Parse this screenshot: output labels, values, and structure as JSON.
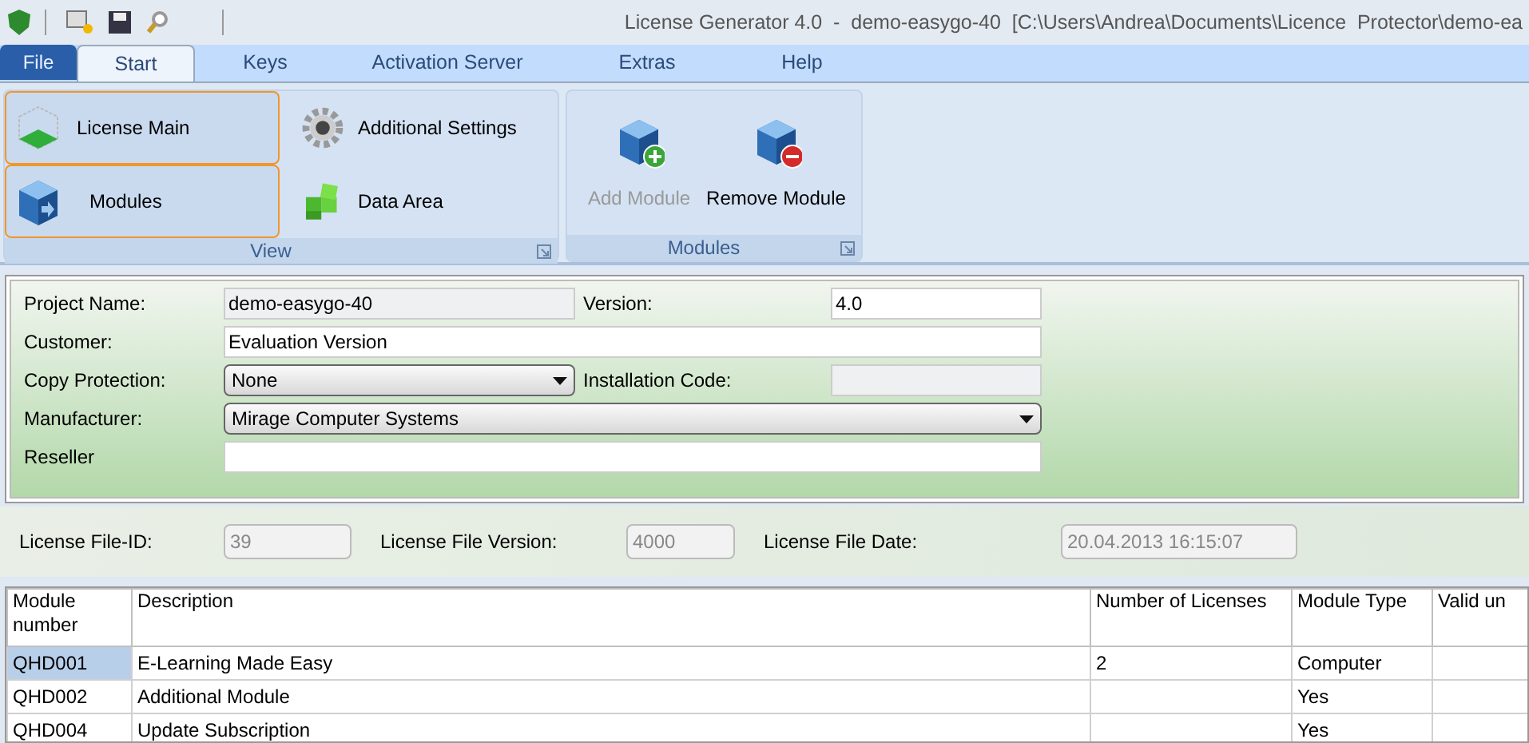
{
  "window": {
    "title": "License Generator 4.0  -  demo-easygo-40  [C:\\Users\\Andrea\\Documents\\Licence  Protector\\demo-ea"
  },
  "tabs": [
    {
      "label": "File",
      "kind": "application",
      "selected": false
    },
    {
      "label": "Start",
      "kind": "tab",
      "selected": true
    },
    {
      "label": "Keys",
      "kind": "tab",
      "selected": false
    },
    {
      "label": "Activation Server",
      "kind": "tab",
      "selected": false
    },
    {
      "label": "Extras",
      "kind": "tab",
      "selected": false
    },
    {
      "label": "Help",
      "kind": "tab",
      "selected": false
    }
  ],
  "ribbon_groups": [
    {
      "label": "View",
      "buttons": [
        {
          "label": "License Main",
          "selected": true,
          "disabled": false
        },
        {
          "label": "Modules",
          "selected": true,
          "disabled": false
        },
        {
          "label": "Additional Settings",
          "selected": false,
          "disabled": false
        },
        {
          "label": "Data Area",
          "selected": false,
          "disabled": false
        }
      ]
    },
    {
      "label": "Modules",
      "buttons": [
        {
          "label": "Add Module",
          "selected": false,
          "disabled": true
        },
        {
          "label": "Remove Module",
          "selected": false,
          "disabled": false
        }
      ]
    }
  ],
  "form": {
    "fields": [
      {
        "label": "Project Name:",
        "value": "demo-easygo-40",
        "kind": "text",
        "readonly": true
      },
      {
        "label": "Version:",
        "value": "4.0",
        "kind": "text",
        "readonly": false
      },
      {
        "label": "Customer:",
        "value": "Evaluation Version",
        "kind": "text",
        "readonly": false
      },
      {
        "label": "Copy Protection:",
        "value": "None",
        "kind": "dropdown"
      },
      {
        "label": "Installation Code:",
        "kind": "text",
        "readonly": true
      },
      {
        "label": "Manufacturer:",
        "value": "Mirage Computer Systems",
        "kind": "dropdown"
      },
      {
        "label": "Reseller",
        "kind": "text",
        "readonly": false
      }
    ]
  },
  "license_file": [
    {
      "label": "License File-ID:",
      "value": "39",
      "disabled": true
    },
    {
      "label": "License File Version:",
      "value": "4000",
      "disabled": true
    },
    {
      "label": "License File Date:",
      "value": "20.04.2013 16:15:07",
      "disabled": true
    }
  ],
  "table": {
    "columns": [
      "Module\nnumber",
      "Description",
      "Number of Licenses",
      "Module Type",
      "Valid un"
    ],
    "rows": [
      {
        "selected": true,
        "cells": [
          "QHD001",
          "E-Learning Made Easy",
          "2",
          "Computer",
          ""
        ]
      },
      {
        "selected": false,
        "cells": [
          "QHD002",
          "Additional Module",
          "",
          "Yes",
          ""
        ]
      },
      {
        "selected": false,
        "cells": [
          "QHD004",
          "Update Subscription",
          "",
          "Yes",
          ""
        ]
      }
    ]
  }
}
